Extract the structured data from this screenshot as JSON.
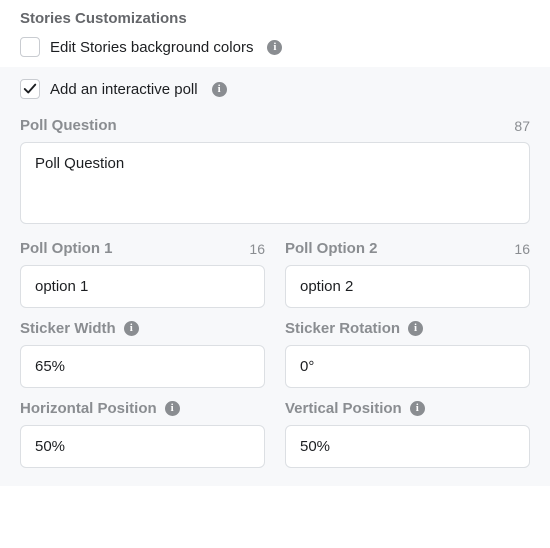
{
  "section_title": "Stories Customizations",
  "edit_bg": {
    "label": "Edit Stories background colors",
    "checked": false
  },
  "add_poll": {
    "label": "Add an interactive poll",
    "checked": true
  },
  "poll_question": {
    "label": "Poll Question",
    "count": "87",
    "value": "Poll Question"
  },
  "option1": {
    "label": "Poll Option 1",
    "count": "16",
    "value": "option 1"
  },
  "option2": {
    "label": "Poll Option 2",
    "count": "16",
    "value": "option 2"
  },
  "sticker_width": {
    "label": "Sticker Width",
    "value": "65%"
  },
  "sticker_rotation": {
    "label": "Sticker Rotation",
    "value": "0°"
  },
  "h_position": {
    "label": "Horizontal Position",
    "value": "50%"
  },
  "v_position": {
    "label": "Vertical Position",
    "value": "50%"
  }
}
